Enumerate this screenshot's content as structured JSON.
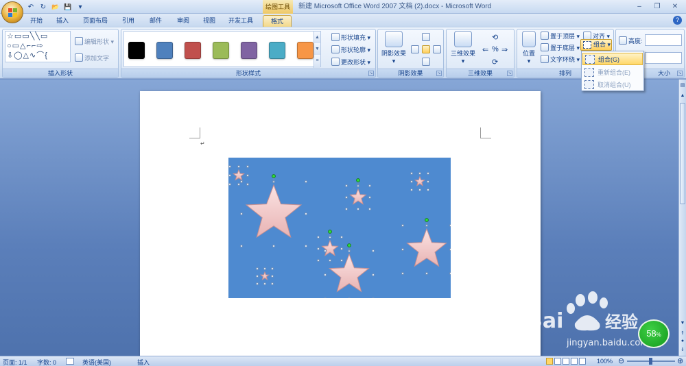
{
  "titlebar": {
    "context_tab": "绘图工具",
    "title": "新建 Microsoft Office Word 2007 文档 (2).docx - Microsoft Word",
    "minimize": "–",
    "restore": "❐",
    "close": "✕"
  },
  "qat": {
    "undo": "↶",
    "redo": "↻",
    "open": "📂",
    "save": "💾",
    "more": "▾"
  },
  "tabs": [
    "开始",
    "插入",
    "页面布局",
    "引用",
    "邮件",
    "审阅",
    "视图",
    "开发工具",
    "格式"
  ],
  "help": "?",
  "ribbon": {
    "insert_shapes": {
      "label": "插入形状",
      "edit_shape": "编辑形状 ▾",
      "add_text": "添加文字",
      "shapes_glyphs": "☆▭▭╲╲▭╱\n○▭△⌐⌐⇨\n⇩◯△∿⌒⌒{"
    },
    "shape_styles": {
      "label": "形状样式",
      "swatches": [
        "#000000",
        "#4f81bd",
        "#c0504d",
        "#9bbb59",
        "#8064a2",
        "#4bacc6",
        "#f79646"
      ],
      "fill": "形状填充 ▾",
      "outline": "形状轮廓 ▾",
      "change": "更改形状 ▾"
    },
    "shadow": {
      "label": "阴影效果",
      "button": "阴影效果"
    },
    "threed": {
      "label": "三维效果",
      "button": "三维效果"
    },
    "arrange": {
      "label": "排列",
      "position": "位置",
      "bring_front": "置于顶层 ▾",
      "send_back": "置于底层 ▾",
      "text_wrap": "文字环绕 ▾",
      "align": "对齐 ▾",
      "group": "组合 ▾"
    },
    "size": {
      "label": "大小",
      "height_label": "高度:"
    }
  },
  "dropdown": {
    "group": "组合(G)",
    "regroup": "重新组合(E)",
    "ungroup": "取消组合(U)"
  },
  "document": {
    "paragraph_mark": "↵"
  },
  "statusbar": {
    "page": "页面: 1/1",
    "words": "字数: 0",
    "lang": "英语(美国)",
    "mode": "插入",
    "zoom": "100%",
    "zoom_minus": "⊖",
    "zoom_plus": "⊕"
  },
  "watermark": {
    "brand": "Bai",
    "brand2": "经验",
    "url": "jingyan.baidu.com"
  },
  "badge": {
    "value": "58",
    "unit": "%"
  }
}
